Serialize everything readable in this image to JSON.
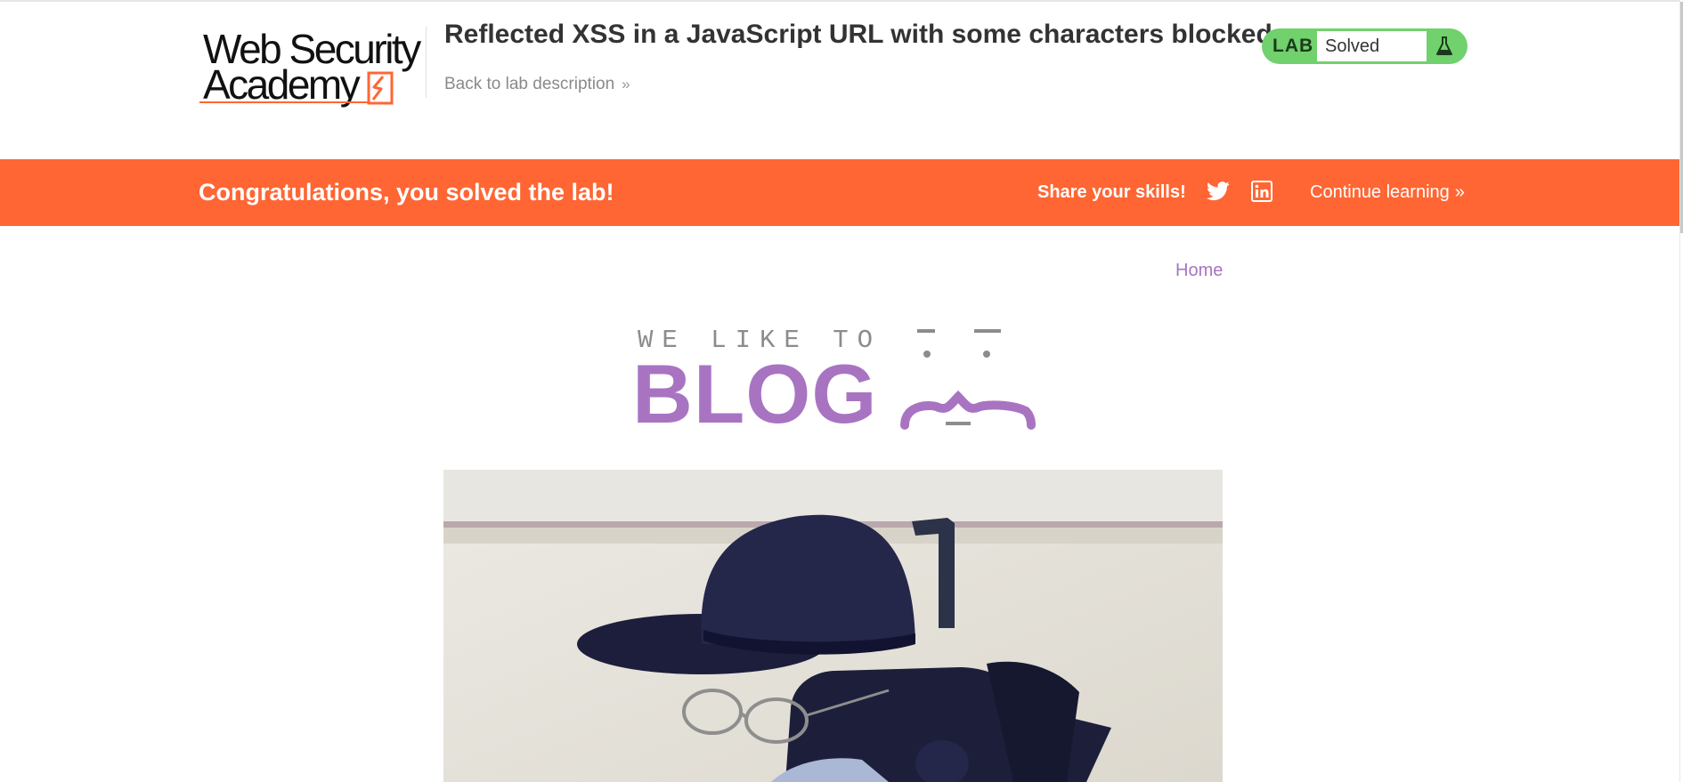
{
  "academy": {
    "logo_line1": "Web Security",
    "logo_line2": "Academy",
    "lab_title": "Reflected XSS in a JavaScript URL with some characters blocked",
    "back_link": "Back to lab description",
    "back_chevron": "»",
    "lab_badge": "LAB",
    "lab_state": "Solved",
    "status_color": "#70d16d",
    "brand_color": "#ff6633"
  },
  "banner": {
    "congrats": "Congratulations, you solved the lab!",
    "share_label": "Share your skills!",
    "share_icons": [
      "twitter-icon",
      "linkedin-icon"
    ],
    "continue_label": "Continue learning",
    "continue_chevron": "»"
  },
  "blog": {
    "nav_home": "Home",
    "tagline": "WE LIKE TO",
    "word": "BLOG",
    "accent_color": "#a874c2",
    "post_image_icon": "invisible-man-photo"
  }
}
